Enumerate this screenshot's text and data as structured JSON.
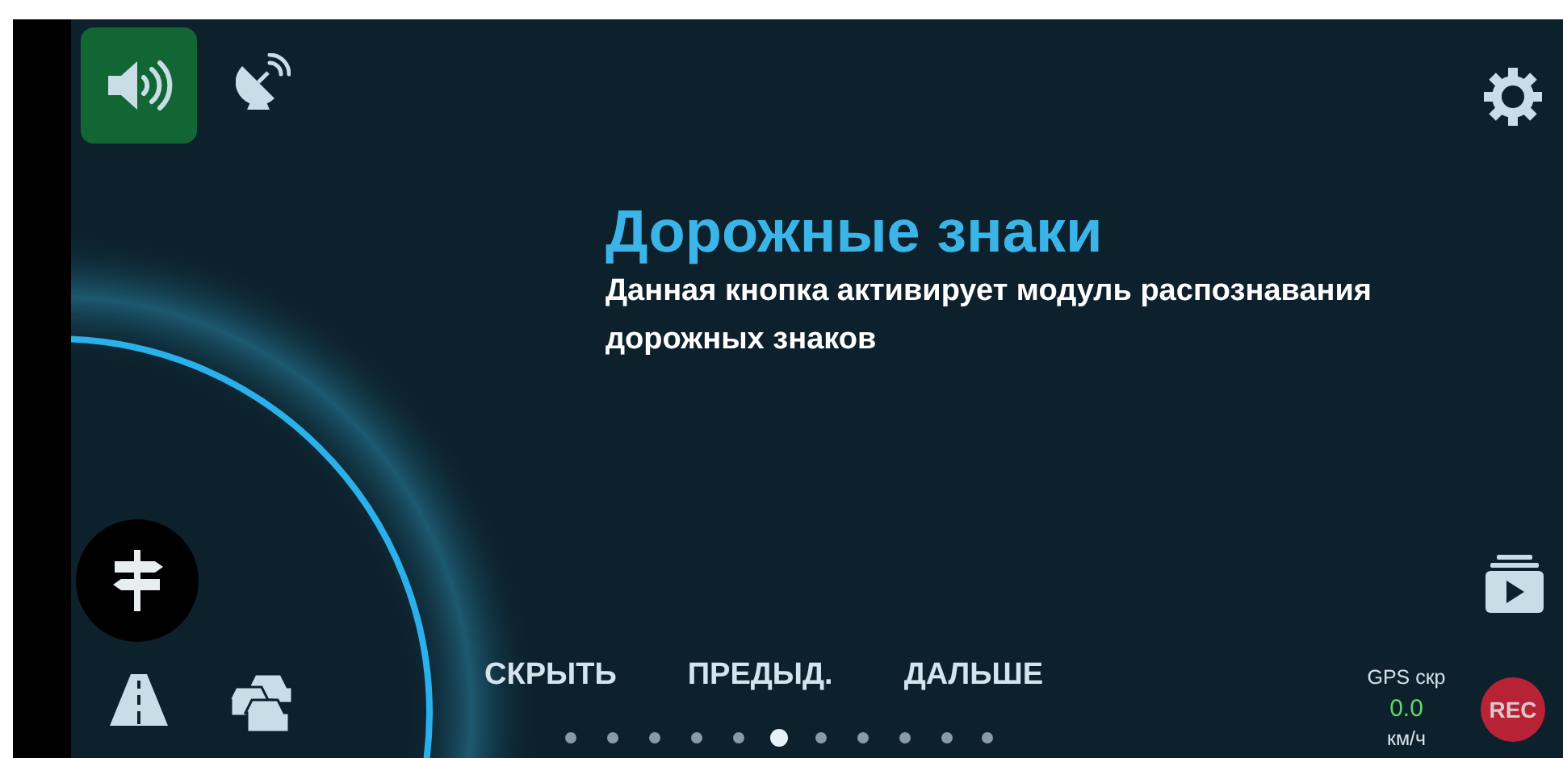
{
  "toolbar": {
    "sound_on": true
  },
  "tip": {
    "title": "Дорожные знаки",
    "text": "Данная кнопка активирует модуль распознавания дорожных знаков"
  },
  "actions": [
    "СКРЫТЬ",
    "ПРЕДЫД.",
    "ДАЛЬШЕ"
  ],
  "pages": [
    {
      "selected": false
    },
    {
      "selected": false
    },
    {
      "selected": false
    },
    {
      "selected": false
    },
    {
      "selected": false
    },
    {
      "selected": true
    },
    {
      "selected": false
    },
    {
      "selected": false
    },
    {
      "selected": false
    },
    {
      "selected": false
    },
    {
      "selected": false
    }
  ],
  "gps": {
    "label": "GPS скр",
    "value": "0.0",
    "unit": "км/ч"
  },
  "rec_button": "REC"
}
